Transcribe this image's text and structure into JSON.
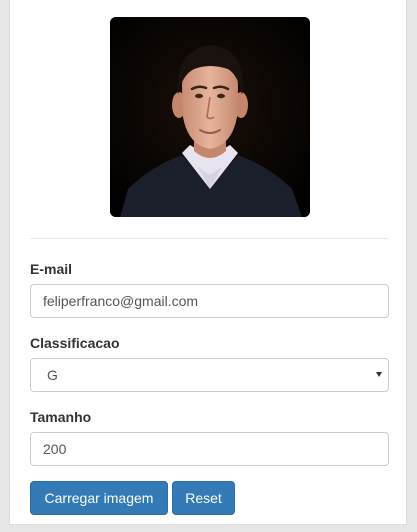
{
  "form": {
    "email_label": "E-mail",
    "email_value": "feliperfranco@gmail.com",
    "classification_label": "Classificacao",
    "classification_value": "G",
    "size_label": "Tamanho",
    "size_value": "200"
  },
  "buttons": {
    "load_label": "Carregar imagem",
    "reset_label": "Reset"
  },
  "colors": {
    "primary": "#337ab7",
    "page_bg": "#e6e6e6"
  },
  "icons": {
    "select_caret": "caret-down-icon"
  }
}
